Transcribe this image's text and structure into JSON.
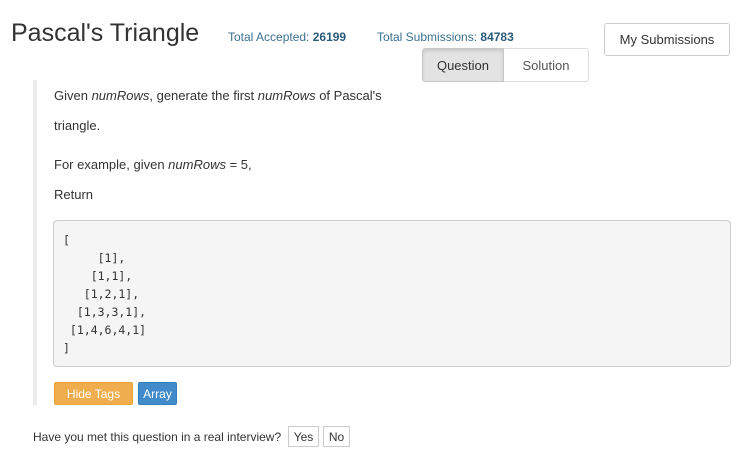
{
  "problem": {
    "title": "Pascal's Triangle",
    "accepted_label": "Total Accepted:",
    "accepted_value": "26199",
    "submissions_label": "Total Submissions:",
    "submissions_value": "84783"
  },
  "header": {
    "my_submissions_label": "My Submissions"
  },
  "tabs": [
    {
      "label": "Question",
      "active": true
    },
    {
      "label": "Solution",
      "active": false
    }
  ],
  "description": {
    "line1_a": "Given ",
    "line1_b": "numRows",
    "line1_c": ", generate the first ",
    "line1_d": "numRows",
    "line1_e": " of Pascal's",
    "line2": "triangle.",
    "line3_a": "For example, given ",
    "line3_b": "numRows",
    "line3_c": " = 5,",
    "line4": "Return"
  },
  "example_code": [
    "[",
    "     [1],",
    "    [1,1],",
    "   [1,2,1],",
    "  [1,3,3,1],",
    " [1,4,6,4,1]",
    "]"
  ],
  "tags": {
    "hide_label": "Hide Tags",
    "items": [
      "Array"
    ]
  },
  "interview": {
    "question": "Have you met this question in a real interview?",
    "yes_label": "Yes",
    "no_label": "No"
  },
  "colors": {
    "warning": "#f0ad4e",
    "primary": "#428bca",
    "stat_text": "#3a6f8f"
  }
}
